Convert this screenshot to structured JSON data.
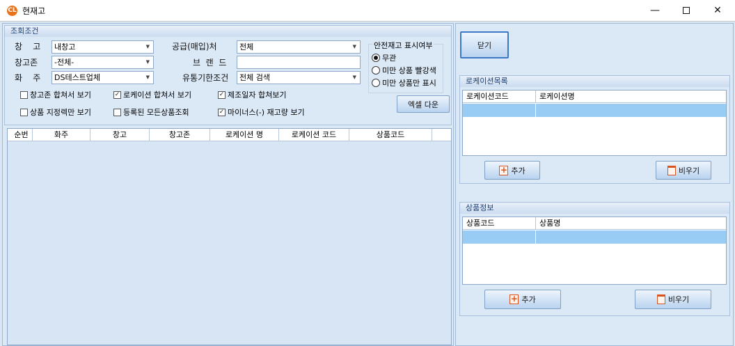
{
  "window": {
    "title": "현재고",
    "logo_text": "CL"
  },
  "search_group": {
    "title": "조회조건",
    "warehouse": {
      "label": "창    고",
      "value": "내창고"
    },
    "zone": {
      "label": "창고존",
      "value": "-전체-"
    },
    "owner": {
      "label": "화    주",
      "value": "DS테스트업체"
    },
    "supplier": {
      "label": "공급(매입)처",
      "value": "전체"
    },
    "brand": {
      "label": "브  랜  드",
      "value": ""
    },
    "expiry": {
      "label": "유통기한조건",
      "value": "전체 검색"
    },
    "safety_stock": {
      "title": "안전재고 표시여부",
      "options": [
        "무관",
        "미만 상품 빨강색",
        "미만 상품만 표시"
      ],
      "selected_index": 0
    },
    "checks": [
      {
        "label": "창고존 합쳐서 보기",
        "checked": false
      },
      {
        "label": "로케이션 합쳐서 보기",
        "checked": true
      },
      {
        "label": "제조일자 합쳐보기",
        "checked": true
      },
      {
        "label": "상품 지정렉만 보기",
        "checked": false
      },
      {
        "label": "등록된 모든상품조회",
        "checked": false
      },
      {
        "label": "마이너스(-) 재고량 보기",
        "checked": true
      }
    ],
    "excel_button": "엑셀 다운"
  },
  "main_grid": {
    "columns": [
      "순번",
      "화주",
      "창고",
      "창고존",
      "로케이션 명",
      "로케이션 코드",
      "상품코드"
    ]
  },
  "right": {
    "close_button": "닫기",
    "location_group": {
      "title": "로케이션목록",
      "columns": [
        "로케이션코드",
        "로케이션명"
      ],
      "add_button": "추가",
      "clear_button": "비우기"
    },
    "product_group": {
      "title": "상품정보",
      "columns": [
        "상품코드",
        "상품명"
      ],
      "add_button": "추가",
      "clear_button": "비우기"
    }
  },
  "colors": {
    "selected_row": "#99ccf5",
    "accent_icon": "#d9531e"
  }
}
